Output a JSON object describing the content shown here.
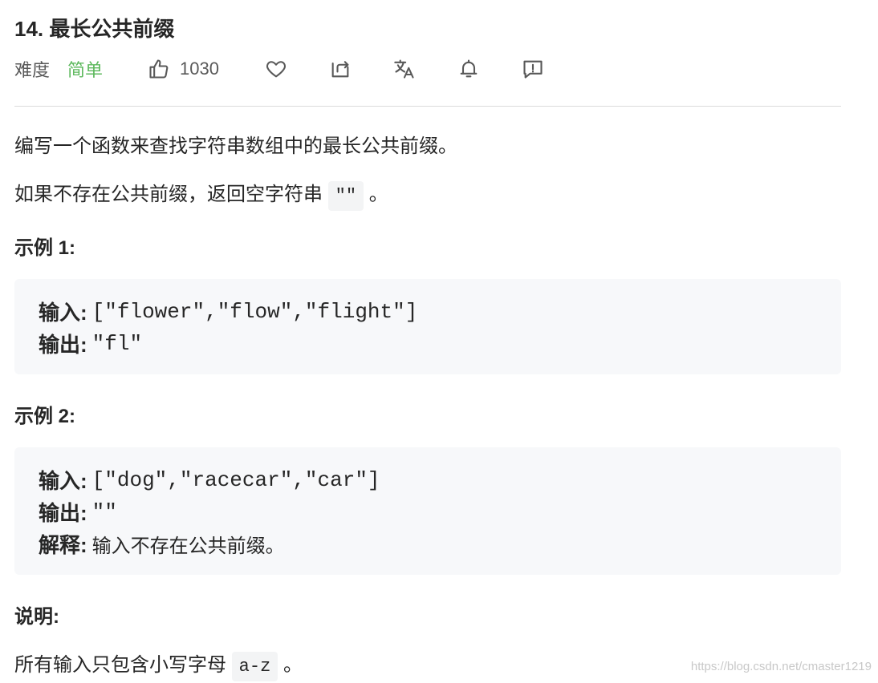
{
  "problem": {
    "title": "14. 最长公共前缀",
    "difficulty_label": "难度",
    "difficulty": "简单",
    "likes": "1030",
    "colors": {
      "easy": "#5cb85c",
      "code_bg": "#f7f8fa"
    }
  },
  "toolbar": {
    "icons": [
      "thumbs-up-icon",
      "heart-icon",
      "share-icon",
      "translate-icon",
      "bell-icon",
      "feedback-icon"
    ]
  },
  "description": {
    "line1": "编写一个函数来查找字符串数组中的最长公共前缀。",
    "line2_text": "如果不存在公共前缀，返回空字符串",
    "line2_code": "\"\"",
    "line2_end": "。"
  },
  "example1": {
    "heading": "示例 1:",
    "input_label": "输入:",
    "input_value": "[\"flower\",\"flow\",\"flight\"]",
    "output_label": "输出:",
    "output_value": "\"fl\""
  },
  "example2": {
    "heading": "示例 2:",
    "input_label": "输入:",
    "input_value": "[\"dog\",\"racecar\",\"car\"]",
    "output_label": "输出:",
    "output_value": "\"\"",
    "explain_label": "解释:",
    "explain_value": "输入不存在公共前缀。"
  },
  "note": {
    "heading": "说明:",
    "text": "所有输入只包含小写字母",
    "code": "a-z",
    "end": "。"
  },
  "watermark": "https://blog.csdn.net/cmaster1219"
}
